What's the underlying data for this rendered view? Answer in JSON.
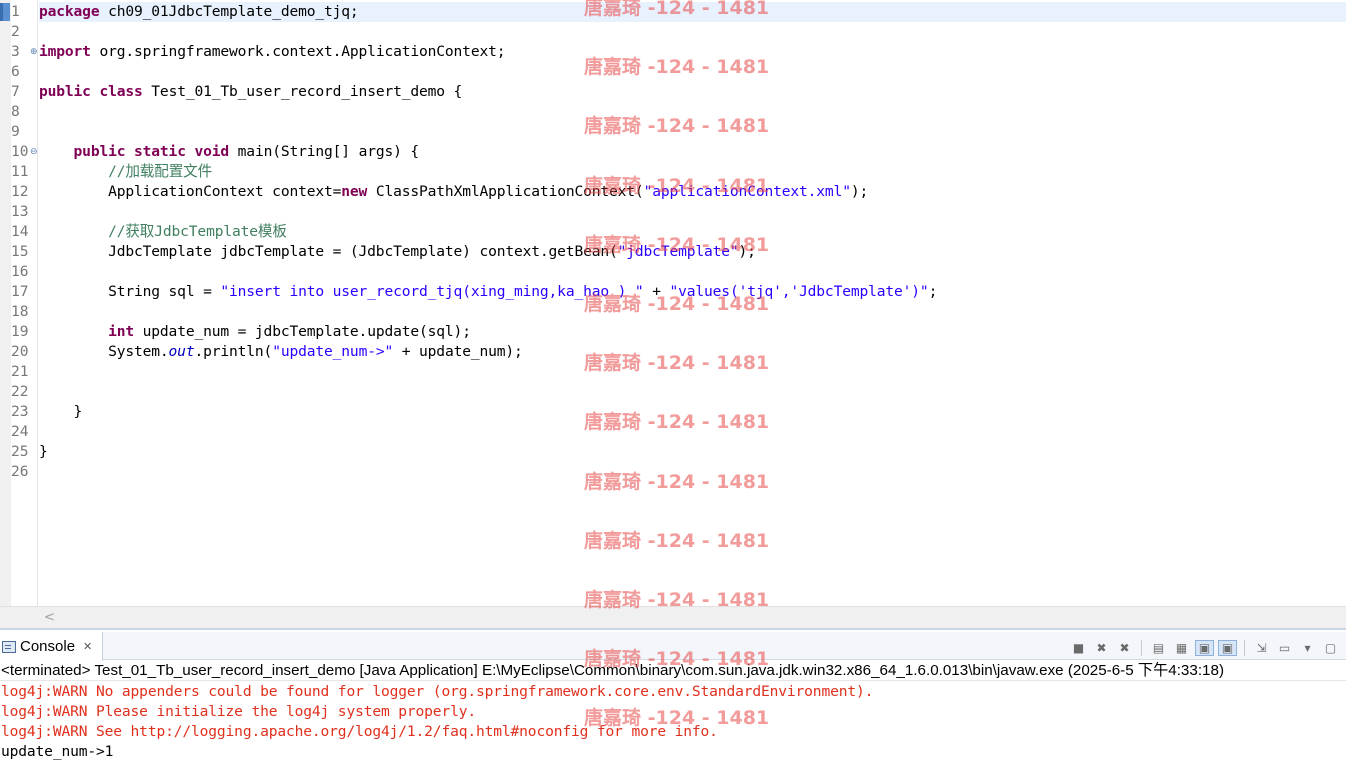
{
  "editor": {
    "lines": [
      {
        "num": "1",
        "segments": [
          {
            "t": "package",
            "c": "kw"
          },
          {
            "t": " ch09_01JdbcTemplate_demo_tjq;",
            "c": ""
          }
        ]
      },
      {
        "num": "2",
        "segments": []
      },
      {
        "num": "3",
        "fold": "plus",
        "segments": [
          {
            "t": "import",
            "c": "kw"
          },
          {
            "t": " org.springframework.context.ApplicationContext;",
            "c": ""
          }
        ]
      },
      {
        "num": "6",
        "segments": []
      },
      {
        "num": "7",
        "segments": [
          {
            "t": "public",
            "c": "kw"
          },
          {
            "t": " ",
            "c": ""
          },
          {
            "t": "class",
            "c": "kw"
          },
          {
            "t": " Test_01_Tb_user_record_insert_demo {",
            "c": ""
          }
        ]
      },
      {
        "num": "8",
        "segments": []
      },
      {
        "num": "9",
        "segments": []
      },
      {
        "num": "10",
        "fold": "minus",
        "segments": [
          {
            "t": "    ",
            "c": ""
          },
          {
            "t": "public",
            "c": "kw"
          },
          {
            "t": " ",
            "c": ""
          },
          {
            "t": "static",
            "c": "kw"
          },
          {
            "t": " ",
            "c": ""
          },
          {
            "t": "void",
            "c": "kw"
          },
          {
            "t": " main(String[] args) {",
            "c": ""
          }
        ]
      },
      {
        "num": "11",
        "segments": [
          {
            "t": "        ",
            "c": ""
          },
          {
            "t": "//加载配置文件",
            "c": "cmt"
          }
        ]
      },
      {
        "num": "12",
        "segments": [
          {
            "t": "        ApplicationContext context=",
            "c": ""
          },
          {
            "t": "new",
            "c": "kw"
          },
          {
            "t": " ClassPathXmlApplicationContext(",
            "c": ""
          },
          {
            "t": "\"applicationContext.xml\"",
            "c": "str"
          },
          {
            "t": ");",
            "c": ""
          }
        ]
      },
      {
        "num": "13",
        "segments": []
      },
      {
        "num": "14",
        "segments": [
          {
            "t": "        ",
            "c": ""
          },
          {
            "t": "//获取JdbcTemplate模板",
            "c": "cmt"
          }
        ]
      },
      {
        "num": "15",
        "segments": [
          {
            "t": "        JdbcTemplate jdbcTemplate = (JdbcTemplate) context.getBean(",
            "c": ""
          },
          {
            "t": "\"jdbcTemplate\"",
            "c": "str"
          },
          {
            "t": ");",
            "c": ""
          }
        ]
      },
      {
        "num": "16",
        "segments": []
      },
      {
        "num": "17",
        "segments": [
          {
            "t": "        String sql = ",
            "c": ""
          },
          {
            "t": "\"insert into user_record_tjq(xing_ming,ka_hao ) \"",
            "c": "str"
          },
          {
            "t": " + ",
            "c": ""
          },
          {
            "t": "\"values('tjq','JdbcTemplate')\"",
            "c": "str"
          },
          {
            "t": ";",
            "c": ""
          }
        ]
      },
      {
        "num": "18",
        "segments": []
      },
      {
        "num": "19",
        "segments": [
          {
            "t": "        ",
            "c": ""
          },
          {
            "t": "int",
            "c": "kw"
          },
          {
            "t": " update_num = jdbcTemplate.update(sql);",
            "c": ""
          }
        ]
      },
      {
        "num": "20",
        "segments": [
          {
            "t": "        System.",
            "c": ""
          },
          {
            "t": "out",
            "c": "fld"
          },
          {
            "t": ".println(",
            "c": ""
          },
          {
            "t": "\"update_num->\"",
            "c": "str"
          },
          {
            "t": " + update_num);",
            "c": ""
          }
        ]
      },
      {
        "num": "21",
        "segments": []
      },
      {
        "num": "22",
        "segments": []
      },
      {
        "num": "23",
        "segments": [
          {
            "t": "    }",
            "c": ""
          }
        ]
      },
      {
        "num": "24",
        "segments": []
      },
      {
        "num": "25",
        "segments": [
          {
            "t": "}",
            "c": ""
          }
        ]
      },
      {
        "num": "26",
        "segments": []
      }
    ]
  },
  "console": {
    "tab_label": "Console",
    "close_glyph": "✕",
    "status": "<terminated> Test_01_Tb_user_record_insert_demo [Java Application] E:\\MyEclipse\\Common\\binary\\com.sun.java.jdk.win32.x86_64_1.6.0.013\\bin\\javaw.exe (2025-6-5 下午4:33:18)",
    "output": [
      {
        "text": "log4j:WARN No appenders could be found for logger (org.springframework.core.env.StandardEnvironment).",
        "kind": "err"
      },
      {
        "text": "log4j:WARN Please initialize the log4j system properly.",
        "kind": "err"
      },
      {
        "text": "log4j:WARN See http://logging.apache.org/log4j/1.2/faq.html#noconfig for more info.",
        "kind": "err"
      },
      {
        "text": "update_num->1",
        "kind": "std"
      }
    ],
    "toolbar": [
      {
        "name": "terminate-icon",
        "glyph": "■"
      },
      {
        "name": "remove-launch-icon",
        "glyph": "✖"
      },
      {
        "name": "remove-all-terminated-icon",
        "glyph": "✖"
      },
      {
        "sep": true
      },
      {
        "name": "scroll-lock-icon",
        "glyph": "▤"
      },
      {
        "name": "word-wrap-icon",
        "glyph": "▦"
      },
      {
        "name": "show-console-on-stdout-icon",
        "glyph": "▣",
        "selected": true
      },
      {
        "name": "show-console-on-stderr-icon",
        "glyph": "▣",
        "selected": true
      },
      {
        "sep": true
      },
      {
        "name": "pin-console-icon",
        "glyph": "⇲"
      },
      {
        "name": "display-selected-console-icon",
        "glyph": "▭"
      },
      {
        "name": "view-menu-icon",
        "glyph": "▾"
      },
      {
        "name": "open-console-icon",
        "glyph": "▢"
      }
    ]
  },
  "watermark": {
    "text": "唐嘉琦 -124 - 1481",
    "count": 13
  }
}
